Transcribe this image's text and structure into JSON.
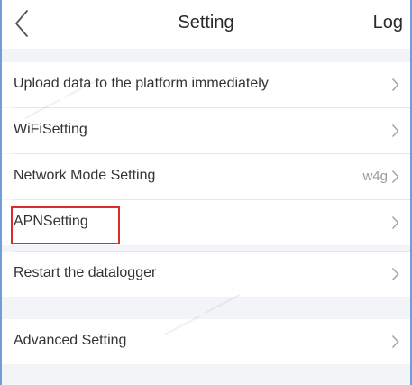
{
  "header": {
    "title": "Setting",
    "log_label": "Log"
  },
  "settings": {
    "group1": [
      {
        "label": "Upload data to the platform immediately",
        "value": ""
      },
      {
        "label": "WiFiSetting",
        "value": ""
      },
      {
        "label": "Network Mode Setting",
        "value": "w4g"
      },
      {
        "label": "APNSetting",
        "value": ""
      },
      {
        "label": "Restart the datalogger",
        "value": ""
      }
    ],
    "group2": [
      {
        "label": "Advanced Setting",
        "value": ""
      }
    ]
  },
  "colors": {
    "background": "#f3f4f7",
    "row_background": "#ffffff",
    "highlight_border": "#dd2b2b",
    "frame_border": "#6f9fd6"
  }
}
